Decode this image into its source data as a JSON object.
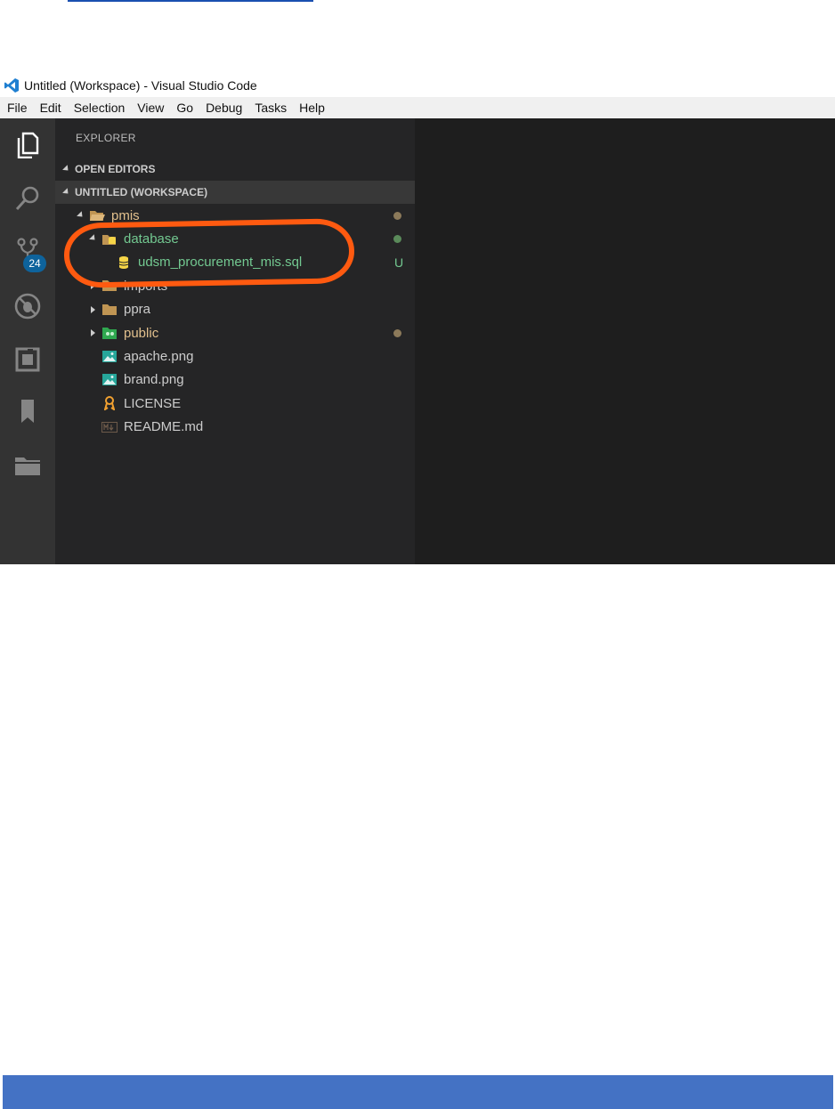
{
  "window": {
    "title": "Untitled (Workspace) - Visual Studio Code"
  },
  "menu": [
    "File",
    "Edit",
    "Selection",
    "View",
    "Go",
    "Debug",
    "Tasks",
    "Help"
  ],
  "activity_bar": {
    "icons": [
      "files-icon",
      "search-icon",
      "source-control-icon",
      "debug-icon",
      "extensions-icon",
      "bookmark-icon",
      "folder-icon"
    ],
    "scm_badge": "24"
  },
  "sidebar": {
    "header": "EXPLORER",
    "open_editors": "OPEN EDITORS",
    "workspace": "UNTITLED (WORKSPACE)"
  },
  "tree": [
    {
      "label": "pmis",
      "color": "#e2c08d",
      "dot": "#8c7a5a"
    },
    {
      "label": "database",
      "color": "#73c991",
      "dot": "#5a8a5a"
    },
    {
      "label": "udsm_procurement_mis.sql",
      "color": "#73c991",
      "status": "U"
    },
    {
      "label": "imports",
      "color": "#cccccc"
    },
    {
      "label": "ppra",
      "color": "#cccccc"
    },
    {
      "label": "public",
      "color": "#e2c08d",
      "dot": "#8c7a5a"
    },
    {
      "label": "apache.png",
      "color": "#cccccc"
    },
    {
      "label": "brand.png",
      "color": "#cccccc"
    },
    {
      "label": "LICENSE",
      "color": "#cccccc"
    },
    {
      "label": "README.md",
      "color": "#cccccc"
    }
  ],
  "colors": {
    "highlight": "#ff5a10",
    "footer_bar": "#4472c4",
    "link_underline": "#1a4fb0"
  }
}
